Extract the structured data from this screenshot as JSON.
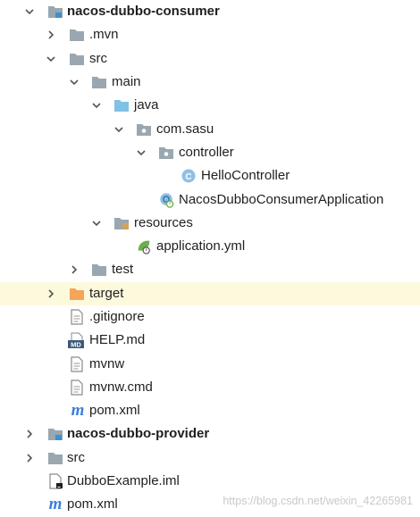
{
  "project_tree": {
    "rows": [
      {
        "label": "nacos-dubbo-consumer",
        "bold": true,
        "arrow": "down",
        "icon": "module-folder-icon"
      },
      {
        "label": ".mvn",
        "arrow": "right",
        "icon": "folder-icon"
      },
      {
        "label": "src",
        "arrow": "down",
        "icon": "folder-icon"
      },
      {
        "label": "main",
        "arrow": "down",
        "icon": "folder-icon"
      },
      {
        "label": "java",
        "arrow": "down",
        "icon": "source-folder-icon"
      },
      {
        "label": "com.sasu",
        "arrow": "down",
        "icon": "package-icon"
      },
      {
        "label": "controller",
        "arrow": "down",
        "icon": "package-icon"
      },
      {
        "label": "HelloController",
        "arrow": "none",
        "icon": "class-icon"
      },
      {
        "label": "NacosDubboConsumerApplication",
        "arrow": "none",
        "icon": "spring-boot-class-icon"
      },
      {
        "label": "resources",
        "arrow": "down",
        "icon": "resources-folder-icon"
      },
      {
        "label": "application.yml",
        "arrow": "none",
        "icon": "spring-yml-icon"
      },
      {
        "label": "test",
        "arrow": "right",
        "icon": "folder-icon"
      },
      {
        "label": "target",
        "arrow": "right",
        "icon": "excluded-folder-icon",
        "selected": true
      },
      {
        "label": ".gitignore",
        "arrow": "none",
        "icon": "file-icon"
      },
      {
        "label": "HELP.md",
        "arrow": "none",
        "icon": "markdown-icon"
      },
      {
        "label": "mvnw",
        "arrow": "none",
        "icon": "file-icon"
      },
      {
        "label": "mvnw.cmd",
        "arrow": "none",
        "icon": "file-icon"
      },
      {
        "label": "pom.xml",
        "arrow": "none",
        "icon": "maven-pom-icon"
      },
      {
        "label": "nacos-dubbo-provider",
        "bold": true,
        "arrow": "right",
        "icon": "module-folder-icon"
      },
      {
        "label": "src",
        "arrow": "right",
        "icon": "folder-icon"
      },
      {
        "label": "DubboExample.iml",
        "arrow": "none",
        "icon": "iml-file-icon"
      },
      {
        "label": "pom.xml",
        "arrow": "none",
        "icon": "maven-pom-icon"
      }
    ],
    "icon_text": {
      "class": "C",
      "markdown": "MD",
      "pom": "m"
    }
  },
  "watermark": "https://blog.csdn.net/weixin_42265981",
  "colors": {
    "folder": "#9aa7b0",
    "source_folder": "#7fc2e5",
    "excluded_folder": "#f4a55a",
    "class_circle": "#8fbfe6",
    "spring_green": "#6ab04c",
    "selected_row": "#fdf9dc"
  }
}
